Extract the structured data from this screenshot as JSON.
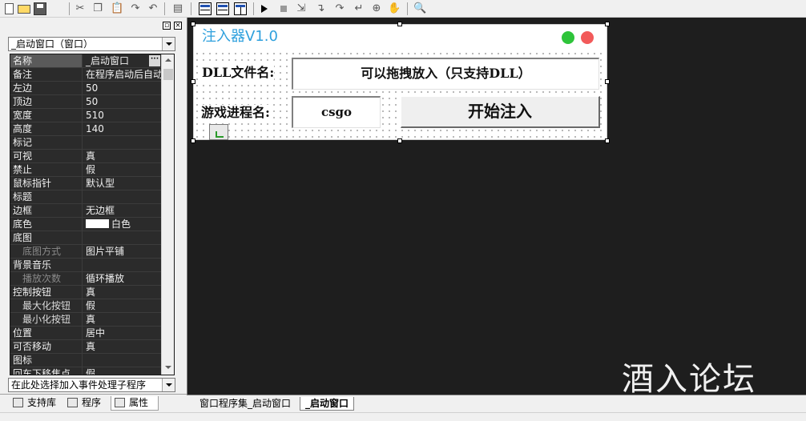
{
  "toolbar": {
    "icons": [
      "new-file-icon",
      "open-folder-icon",
      "save-icon",
      "cut-icon",
      "copy-icon",
      "paste-icon",
      "redo-icon",
      "undo-icon",
      "view-icon",
      "layout-grid-icon",
      "layout-rows-icon",
      "layout-cols-icon",
      "run-icon",
      "stop-icon",
      "step-icon",
      "step-into-icon",
      "step-over-icon",
      "step-out-icon",
      "breakpoint-icon",
      "hand-icon",
      "find-icon"
    ]
  },
  "left_panel": {
    "object_select": "_启动窗口（窗口）",
    "event_select": "在此处选择加入事件处理子程序",
    "properties": [
      {
        "name": "名称",
        "value": "_启动窗口",
        "kind": "selected"
      },
      {
        "name": "备注",
        "value": "在程序启动后自动"
      },
      {
        "name": "左边",
        "value": "50"
      },
      {
        "name": "顶边",
        "value": "50"
      },
      {
        "name": "宽度",
        "value": "510"
      },
      {
        "name": "高度",
        "value": "140"
      },
      {
        "name": "标记",
        "value": ""
      },
      {
        "name": "可视",
        "value": "真"
      },
      {
        "name": "禁止",
        "value": "假"
      },
      {
        "name": "鼠标指针",
        "value": "默认型"
      },
      {
        "name": "标题",
        "value": ""
      },
      {
        "name": "边框",
        "value": "无边框"
      },
      {
        "name": "底色",
        "value": "白色",
        "kind": "color"
      },
      {
        "name": "底图",
        "value": ""
      },
      {
        "name": "底图方式",
        "value": "图片平铺",
        "kind": "dim"
      },
      {
        "name": "背景音乐",
        "value": ""
      },
      {
        "name": "播放次数",
        "value": "循环播放",
        "kind": "dim"
      },
      {
        "name": "控制按钮",
        "value": "真"
      },
      {
        "name": "最大化按钮",
        "value": "假",
        "kind": "sub"
      },
      {
        "name": "最小化按钮",
        "value": "真",
        "kind": "sub"
      },
      {
        "name": "位置",
        "value": "居中"
      },
      {
        "name": "可否移动",
        "value": "真"
      },
      {
        "name": "图标",
        "value": ""
      },
      {
        "name": "回车下移焦点",
        "value": "假"
      }
    ],
    "bottom_tabs": [
      "支持库",
      "程序",
      "属性"
    ]
  },
  "form": {
    "title": "注入器V1.0",
    "dll_label": "DLL文件名:",
    "dll_value": "可以拖拽放入（只支持DLL）",
    "process_label": "游戏进程名:",
    "process_value": "csgo",
    "inject_button": "开始注入",
    "dot_colors": [
      "#2ec43a",
      "#f25a5a"
    ]
  },
  "watermark": "酒入论坛",
  "workspace_tabs": [
    "窗口程序集_启动窗口",
    "_启动窗口"
  ]
}
